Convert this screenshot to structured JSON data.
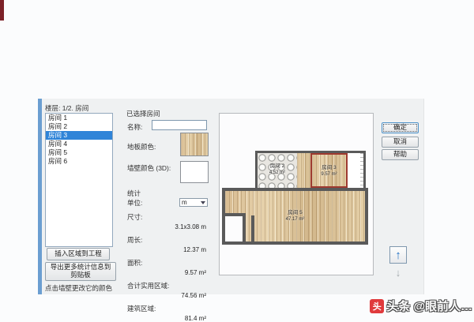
{
  "dialog": {
    "left_panel": {
      "header": "楼层: 1/2. 房间",
      "rooms": [
        {
          "label": "房间 1"
        },
        {
          "label": "房间 2"
        },
        {
          "label": "房间 3"
        },
        {
          "label": "房间 4"
        },
        {
          "label": "房间 5"
        },
        {
          "label": "房间 6"
        }
      ],
      "selected_room": "房间 3",
      "insert_button": "插入区域到工程",
      "export_button": "导出更多统计信息到剪贴板",
      "hint": "点击墙壁更改它的颜色"
    },
    "room_panel": {
      "title": "已选择房间",
      "name_label": "名称:",
      "name_value": "",
      "floor_color_label": "地板颜色:",
      "wall_color_label": "墙壁颜色 (3D):",
      "stats": {
        "title": "统计",
        "unit_label": "单位:",
        "unit_value": "m",
        "size_label": "尺寸:",
        "size_value": "3.1x3.08 m",
        "perimeter_label": "周长:",
        "perimeter_value": "12.37 m",
        "area_label": "面积:",
        "area_value": "9.57 m²",
        "usable_label": "合计实用区域:",
        "usable_value": "74.56 m²",
        "building_label": "建筑区域:",
        "building_value": "81.4 m²"
      }
    },
    "plan": {
      "tile_room": {
        "name": "房间 2",
        "area": "4.52 m²"
      },
      "selected_room": {
        "name": "房间 3",
        "area": "9.57 m²"
      },
      "large_room": {
        "name": "房间 5",
        "area": "47.17 m²"
      }
    },
    "actions": {
      "ok": "确定",
      "cancel": "取消",
      "help": "帮助"
    },
    "nav": {
      "up": "↑",
      "down": "↓"
    }
  },
  "watermark": {
    "brand": "头",
    "text": "头条 @眼前人…"
  },
  "colors": {
    "selection_blue": "#2f84d8",
    "dialog_edge_blue": "#6b9ed1",
    "wall_gray": "#5a5a5a",
    "selected_room_red": "#9e3a30",
    "watermark_red": "#e03a3c",
    "wood_tan": "#dcc49e"
  }
}
